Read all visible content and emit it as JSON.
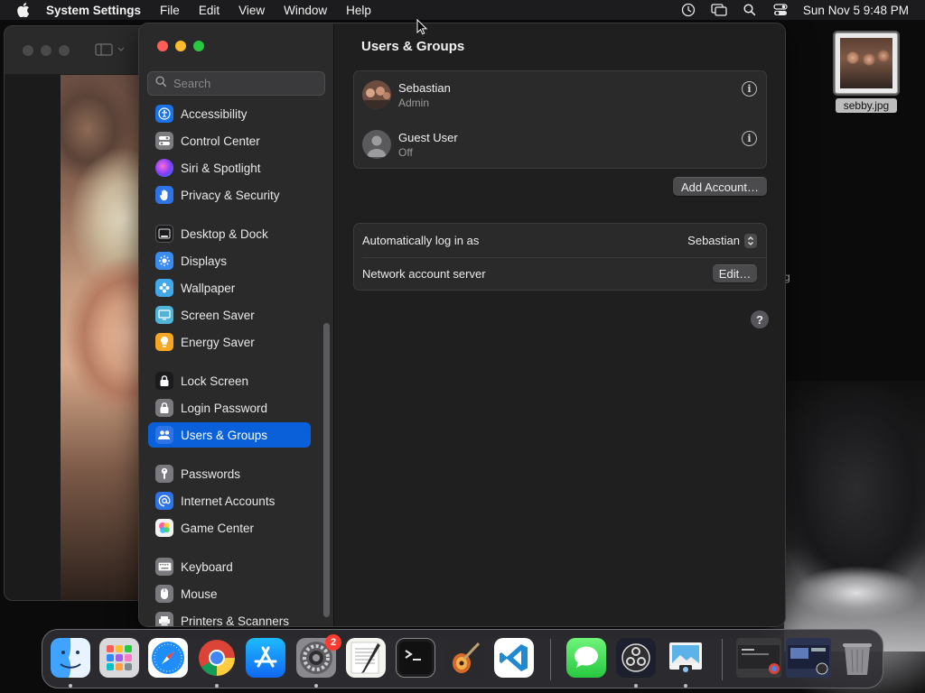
{
  "menubar": {
    "app_name": "System Settings",
    "menus": [
      "File",
      "Edit",
      "View",
      "Window",
      "Help"
    ],
    "clock": "Sun Nov 5  9:48 PM",
    "status_icons": [
      "screen-time-icon",
      "screen-mirroring-icon",
      "search-icon",
      "control-center-icon"
    ]
  },
  "desktop": {
    "file_label": "sebby.jpg",
    "partial_text": "g"
  },
  "sidebar": {
    "search_placeholder": "Search",
    "items": [
      {
        "label": "Accessibility",
        "icon": "accessibility-icon",
        "color": "#1a73e8"
      },
      {
        "label": "Control Center",
        "icon": "control-center-icon",
        "color": "#7c7c80"
      },
      {
        "label": "Siri & Spotlight",
        "icon": "siri-icon",
        "color": "#a243d6"
      },
      {
        "label": "Privacy & Security",
        "icon": "hand-icon",
        "color": "#2f74e6"
      },
      {
        "label": "Desktop & Dock",
        "icon": "dock-icon",
        "color": "#2b2b2d"
      },
      {
        "label": "Displays",
        "icon": "displays-icon",
        "color": "#3b8cf0"
      },
      {
        "label": "Wallpaper",
        "icon": "wallpaper-icon",
        "color": "#41a8e9"
      },
      {
        "label": "Screen Saver",
        "icon": "screen-saver-icon",
        "color": "#4fb5d8"
      },
      {
        "label": "Energy Saver",
        "icon": "energy-icon",
        "color": "#f5a623"
      },
      {
        "label": "Lock Screen",
        "icon": "lock-icon",
        "color": "#2a2a2c"
      },
      {
        "label": "Login Password",
        "icon": "password-icon",
        "color": "#7a7a7e"
      },
      {
        "label": "Users & Groups",
        "icon": "users-icon",
        "color": "#2f74e6"
      },
      {
        "label": "Passwords",
        "icon": "key-icon",
        "color": "#7a7a7e"
      },
      {
        "label": "Internet Accounts",
        "icon": "at-icon",
        "color": "#2f74e6"
      },
      {
        "label": "Game Center",
        "icon": "game-center-icon",
        "color": "#e8e8e8"
      },
      {
        "label": "Keyboard",
        "icon": "keyboard-icon",
        "color": "#7a7a7e"
      },
      {
        "label": "Mouse",
        "icon": "mouse-icon",
        "color": "#7a7a7e"
      },
      {
        "label": "Printers & Scanners",
        "icon": "printer-icon",
        "color": "#7a7a7e"
      }
    ],
    "selected": "Users & Groups"
  },
  "main": {
    "title": "Users & Groups",
    "users": [
      {
        "name": "Sebastian",
        "role": "Admin"
      },
      {
        "name": "Guest User",
        "role": "Off"
      }
    ],
    "add_account_label": "Add Account…",
    "auto_login_label": "Automatically log in as",
    "auto_login_value": "Sebastian",
    "network_server_label": "Network account server",
    "edit_label": "Edit…",
    "help_label": "?"
  },
  "dock": {
    "apps": [
      "Finder",
      "Launchpad",
      "Safari",
      "Google Chrome",
      "App Store",
      "System Settings",
      "TextEdit",
      "Terminal",
      "GarageBand",
      "Visual Studio Code",
      "Messages",
      "OBS",
      "Preview"
    ],
    "settings_badge": "2"
  },
  "colors": {
    "accent": "#0a60d8",
    "window_bg": "#1f1f1f",
    "sidebar_bg": "#2a2a2b"
  }
}
